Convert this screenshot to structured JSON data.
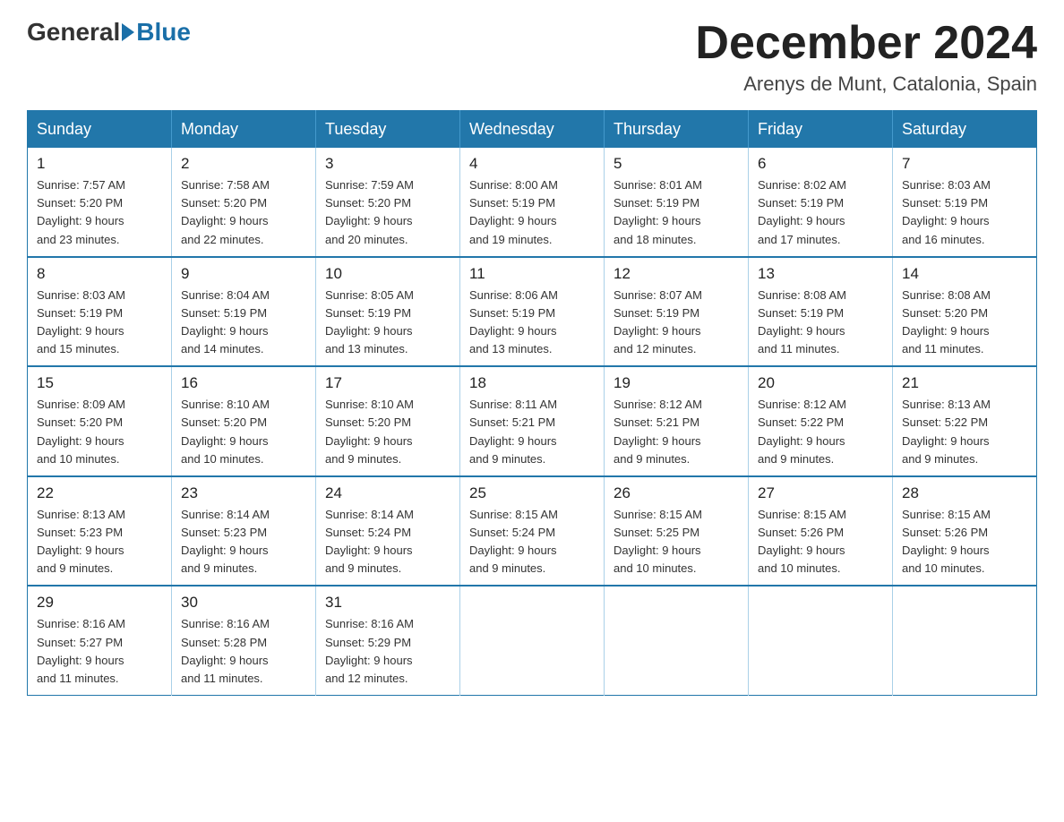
{
  "header": {
    "logo_general": "General",
    "logo_blue": "Blue",
    "month_title": "December 2024",
    "location": "Arenys de Munt, Catalonia, Spain"
  },
  "days_of_week": [
    "Sunday",
    "Monday",
    "Tuesday",
    "Wednesday",
    "Thursday",
    "Friday",
    "Saturday"
  ],
  "weeks": [
    [
      {
        "day": "1",
        "sunrise": "7:57 AM",
        "sunset": "5:20 PM",
        "daylight": "9 hours and 23 minutes."
      },
      {
        "day": "2",
        "sunrise": "7:58 AM",
        "sunset": "5:20 PM",
        "daylight": "9 hours and 22 minutes."
      },
      {
        "day": "3",
        "sunrise": "7:59 AM",
        "sunset": "5:20 PM",
        "daylight": "9 hours and 20 minutes."
      },
      {
        "day": "4",
        "sunrise": "8:00 AM",
        "sunset": "5:19 PM",
        "daylight": "9 hours and 19 minutes."
      },
      {
        "day": "5",
        "sunrise": "8:01 AM",
        "sunset": "5:19 PM",
        "daylight": "9 hours and 18 minutes."
      },
      {
        "day": "6",
        "sunrise": "8:02 AM",
        "sunset": "5:19 PM",
        "daylight": "9 hours and 17 minutes."
      },
      {
        "day": "7",
        "sunrise": "8:03 AM",
        "sunset": "5:19 PM",
        "daylight": "9 hours and 16 minutes."
      }
    ],
    [
      {
        "day": "8",
        "sunrise": "8:03 AM",
        "sunset": "5:19 PM",
        "daylight": "9 hours and 15 minutes."
      },
      {
        "day": "9",
        "sunrise": "8:04 AM",
        "sunset": "5:19 PM",
        "daylight": "9 hours and 14 minutes."
      },
      {
        "day": "10",
        "sunrise": "8:05 AM",
        "sunset": "5:19 PM",
        "daylight": "9 hours and 13 minutes."
      },
      {
        "day": "11",
        "sunrise": "8:06 AM",
        "sunset": "5:19 PM",
        "daylight": "9 hours and 13 minutes."
      },
      {
        "day": "12",
        "sunrise": "8:07 AM",
        "sunset": "5:19 PM",
        "daylight": "9 hours and 12 minutes."
      },
      {
        "day": "13",
        "sunrise": "8:08 AM",
        "sunset": "5:19 PM",
        "daylight": "9 hours and 11 minutes."
      },
      {
        "day": "14",
        "sunrise": "8:08 AM",
        "sunset": "5:20 PM",
        "daylight": "9 hours and 11 minutes."
      }
    ],
    [
      {
        "day": "15",
        "sunrise": "8:09 AM",
        "sunset": "5:20 PM",
        "daylight": "9 hours and 10 minutes."
      },
      {
        "day": "16",
        "sunrise": "8:10 AM",
        "sunset": "5:20 PM",
        "daylight": "9 hours and 10 minutes."
      },
      {
        "day": "17",
        "sunrise": "8:10 AM",
        "sunset": "5:20 PM",
        "daylight": "9 hours and 9 minutes."
      },
      {
        "day": "18",
        "sunrise": "8:11 AM",
        "sunset": "5:21 PM",
        "daylight": "9 hours and 9 minutes."
      },
      {
        "day": "19",
        "sunrise": "8:12 AM",
        "sunset": "5:21 PM",
        "daylight": "9 hours and 9 minutes."
      },
      {
        "day": "20",
        "sunrise": "8:12 AM",
        "sunset": "5:22 PM",
        "daylight": "9 hours and 9 minutes."
      },
      {
        "day": "21",
        "sunrise": "8:13 AM",
        "sunset": "5:22 PM",
        "daylight": "9 hours and 9 minutes."
      }
    ],
    [
      {
        "day": "22",
        "sunrise": "8:13 AM",
        "sunset": "5:23 PM",
        "daylight": "9 hours and 9 minutes."
      },
      {
        "day": "23",
        "sunrise": "8:14 AM",
        "sunset": "5:23 PM",
        "daylight": "9 hours and 9 minutes."
      },
      {
        "day": "24",
        "sunrise": "8:14 AM",
        "sunset": "5:24 PM",
        "daylight": "9 hours and 9 minutes."
      },
      {
        "day": "25",
        "sunrise": "8:15 AM",
        "sunset": "5:24 PM",
        "daylight": "9 hours and 9 minutes."
      },
      {
        "day": "26",
        "sunrise": "8:15 AM",
        "sunset": "5:25 PM",
        "daylight": "9 hours and 10 minutes."
      },
      {
        "day": "27",
        "sunrise": "8:15 AM",
        "sunset": "5:26 PM",
        "daylight": "9 hours and 10 minutes."
      },
      {
        "day": "28",
        "sunrise": "8:15 AM",
        "sunset": "5:26 PM",
        "daylight": "9 hours and 10 minutes."
      }
    ],
    [
      {
        "day": "29",
        "sunrise": "8:16 AM",
        "sunset": "5:27 PM",
        "daylight": "9 hours and 11 minutes."
      },
      {
        "day": "30",
        "sunrise": "8:16 AM",
        "sunset": "5:28 PM",
        "daylight": "9 hours and 11 minutes."
      },
      {
        "day": "31",
        "sunrise": "8:16 AM",
        "sunset": "5:29 PM",
        "daylight": "9 hours and 12 minutes."
      },
      null,
      null,
      null,
      null
    ]
  ],
  "labels": {
    "sunrise_prefix": "Sunrise: ",
    "sunset_prefix": "Sunset: ",
    "daylight_prefix": "Daylight: "
  }
}
